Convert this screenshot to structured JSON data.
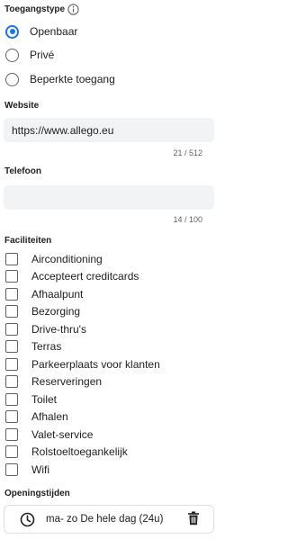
{
  "access": {
    "title": "Toegangstype",
    "icon": "info-icon",
    "options": [
      {
        "label": "Openbaar",
        "checked": true
      },
      {
        "label": "Privé",
        "checked": false
      },
      {
        "label": "Beperkte toegang",
        "checked": false
      }
    ]
  },
  "website": {
    "title": "Website",
    "value": "https://www.allego.eu",
    "counter": "21 / 512"
  },
  "phone": {
    "title": "Telefoon",
    "value": "",
    "counter": "14 / 100"
  },
  "facilities": {
    "title": "Faciliteiten",
    "items": [
      "Airconditioning",
      "Accepteert creditcards",
      "Afhaalpunt",
      "Bezorging",
      "Drive-thru's",
      "Terras",
      "Parkeerplaats voor klanten",
      "Reserveringen",
      "Toilet",
      "Afhalen",
      "Valet-service",
      "Rolstoeltoegankelijk",
      "Wifi"
    ]
  },
  "hours": {
    "title": "Openingstijden",
    "entry": "ma- zo De hele dag (24u)",
    "icons": {
      "clock": "clock-icon",
      "delete": "trash-icon"
    }
  },
  "colors": {
    "accent": "#1a73e8",
    "field_bg": "#f1f3f4",
    "text": "#202124",
    "muted": "#5f6368"
  }
}
